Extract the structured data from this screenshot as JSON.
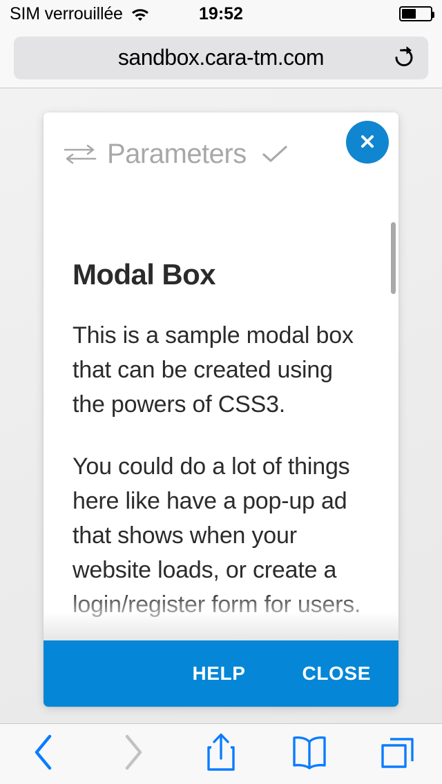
{
  "status_bar": {
    "carrier": "SIM verrouillée",
    "wifi_icon": "wifi-icon",
    "time": "19:52",
    "battery_icon": "battery-icon",
    "battery_level_percent": 45
  },
  "browser": {
    "url": "sandbox.cara-tm.com",
    "reload_icon": "reload-icon",
    "toolbar": {
      "back_icon": "chevron-left-icon",
      "forward_icon": "chevron-right-icon",
      "share_icon": "share-icon",
      "bookmarks_icon": "book-icon",
      "tabs_icon": "tabs-icon",
      "back_enabled": true,
      "forward_enabled": false
    }
  },
  "modal": {
    "header": {
      "swap_icon": "swap-horizontal-icon",
      "title": "Parameters",
      "check_icon": "check-icon",
      "close_icon": "close-icon"
    },
    "heading": "Modal Box",
    "paragraphs": [
      "This is a sample modal box that can be created using the powers of CSS3.",
      "You could do a lot of things here like have a pop-up ad that shows when your website loads, or create a login/register form for users."
    ],
    "footer": {
      "help_label": "HELP",
      "close_label": "CLOSE"
    }
  },
  "colors": {
    "accent_blue": "#0586d6",
    "close_button_blue": "#1186d0",
    "toolbar_blue": "#0a7cff",
    "muted_grey": "#a8a8a8",
    "text_dark": "#2b2b2b"
  }
}
